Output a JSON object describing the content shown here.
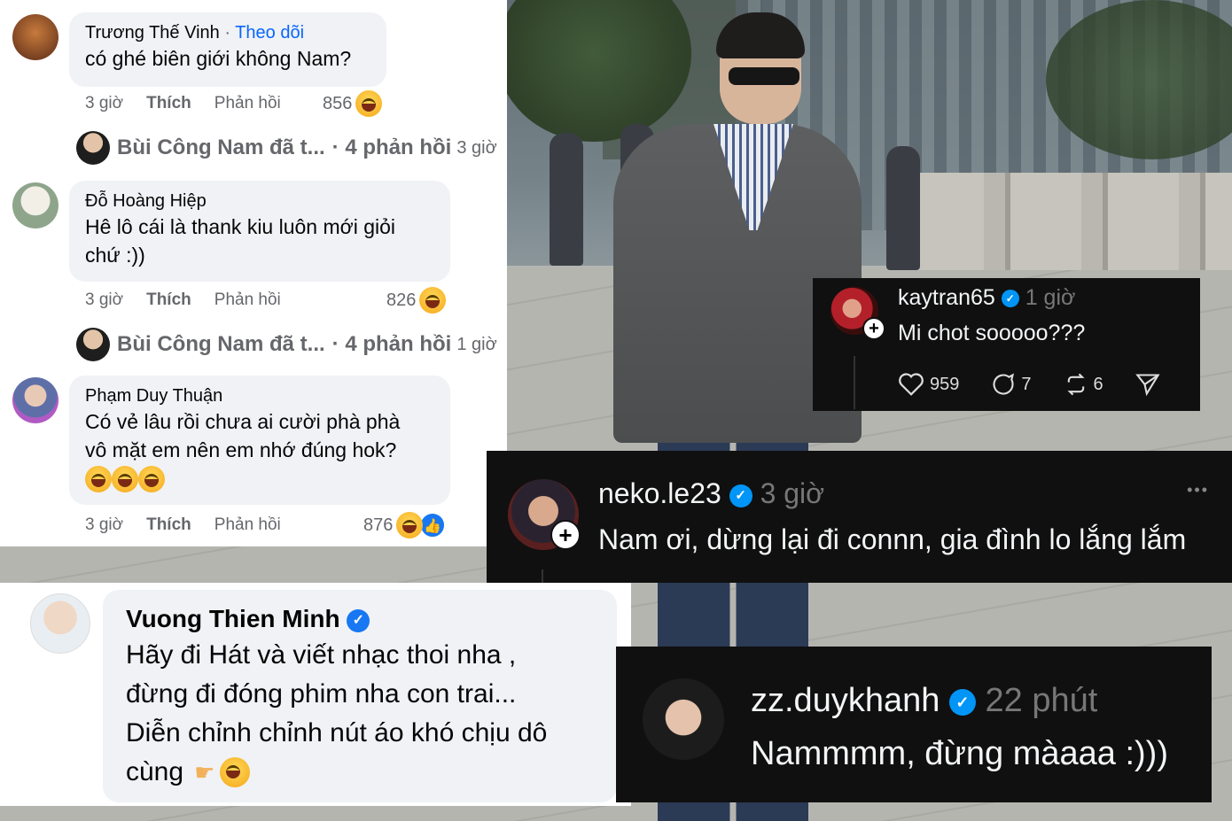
{
  "facebook_comments": [
    {
      "author": "Trương Thế Vinh",
      "follow_label": "Theo dõi",
      "text": "có ghé biên giới không Nam?",
      "time": "3 giờ",
      "like_label": "Thích",
      "reply_label": "Phản hồi",
      "reaction_count": "856",
      "replies": {
        "author_line": "Bùi Công Nam đã t...",
        "count_label": "· 4 phản hồi",
        "time": "3 giờ"
      }
    },
    {
      "author": "Đỗ Hoàng Hiệp",
      "text_line1": "Hê lô cái là thank kiu luôn mới giỏi",
      "text_line2": "chứ :))",
      "time": "3 giờ",
      "like_label": "Thích",
      "reply_label": "Phản hồi",
      "reaction_count": "826",
      "replies": {
        "author_line": "Bùi Công Nam đã t...",
        "count_label": "· 4 phản hồi",
        "time": "1 giờ"
      }
    },
    {
      "author": "Phạm Duy Thuận",
      "text_line1": "Có vẻ lâu rồi chưa ai cười phà phà",
      "text_line2": "vô mặt em nên em nhớ đúng hok?",
      "time": "3 giờ",
      "like_label": "Thích",
      "reply_label": "Phản hồi",
      "reaction_count": "876"
    }
  ],
  "facebook_featured": {
    "author": "Vuong Thien Minh",
    "line1": "Hãy đi Hát và viết nhạc thoi nha ,",
    "line2": "đừng đi đóng phim nha con trai...",
    "line3": "Diễn chỉnh chỉnh nút áo khó chịu dô",
    "line4": "cùng"
  },
  "threads_comments": [
    {
      "username": "kaytran65",
      "time": "1 giờ",
      "text": "Mi chot sooooo???",
      "likes": "959",
      "replies": "7",
      "reposts": "6"
    },
    {
      "username": "neko.le23",
      "time": "3 giờ",
      "text": "Nam ơi, dừng lại đi connn, gia đình lo lắng lắm",
      "more_label": "•••"
    },
    {
      "username": "zz.duykhanh",
      "time": "22 phút",
      "text": "Nammmm, đừng màaaa :)))"
    }
  ],
  "colors": {
    "facebook_blue": "#0866ff",
    "threads_bg": "#101010",
    "verified_blue": "#0095f6",
    "bubble_bg": "#f0f2f5"
  },
  "icons": {
    "reaction_primary": "haha-emoji-icon",
    "reaction_secondary": "like-reaction-icon",
    "threads_like": "heart-icon",
    "threads_reply": "comment-icon",
    "threads_repost": "repost-icon",
    "threads_share": "send-icon"
  }
}
